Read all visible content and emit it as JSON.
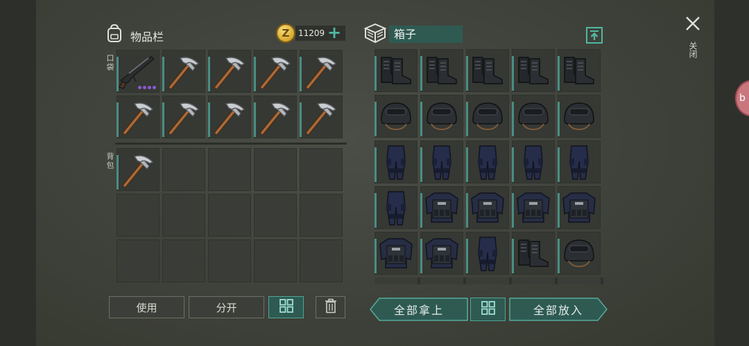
{
  "inventory": {
    "title": "物品栏",
    "title_icon": "backpack-icon",
    "money": "11209",
    "coin_symbol": "Z",
    "add_icon": "plus-icon",
    "pocket_label": "口袋",
    "backpack_label": "背包",
    "pocket_items": [
      "shotgun",
      "pickaxe",
      "pickaxe",
      "pickaxe",
      "pickaxe",
      "pickaxe",
      "pickaxe",
      "pickaxe",
      "pickaxe",
      "pickaxe"
    ],
    "backpack_items": [
      "pickaxe",
      "",
      "",
      "",
      "",
      "",
      "",
      "",
      "",
      "",
      "",
      "",
      "",
      "",
      ""
    ]
  },
  "box": {
    "title": "箱子",
    "title_icon": "crate-icon",
    "sort_icon": "upload-icon",
    "items": [
      "boots",
      "boots",
      "boots",
      "boots",
      "boots",
      "helmet",
      "helmet",
      "helmet",
      "helmet",
      "helmet",
      "pants",
      "pants",
      "pants",
      "pants",
      "pants",
      "pants",
      "vest",
      "vest",
      "vest",
      "vest",
      "vest",
      "vest",
      "pants",
      "boots",
      "helmet"
    ]
  },
  "actions": {
    "use": "使用",
    "split": "分开",
    "grid_icon": "grid-icon",
    "trash_icon": "trash-icon",
    "take_all": "全部拿上",
    "put_all": "全部放入"
  },
  "window": {
    "close_icon": "close-icon",
    "close_label": "关闭",
    "bubble_text": "b"
  },
  "colors": {
    "accent": "#4fb8a3",
    "accent_dark": "#2e5a52",
    "rarity_dot": "#8b5ad1"
  }
}
